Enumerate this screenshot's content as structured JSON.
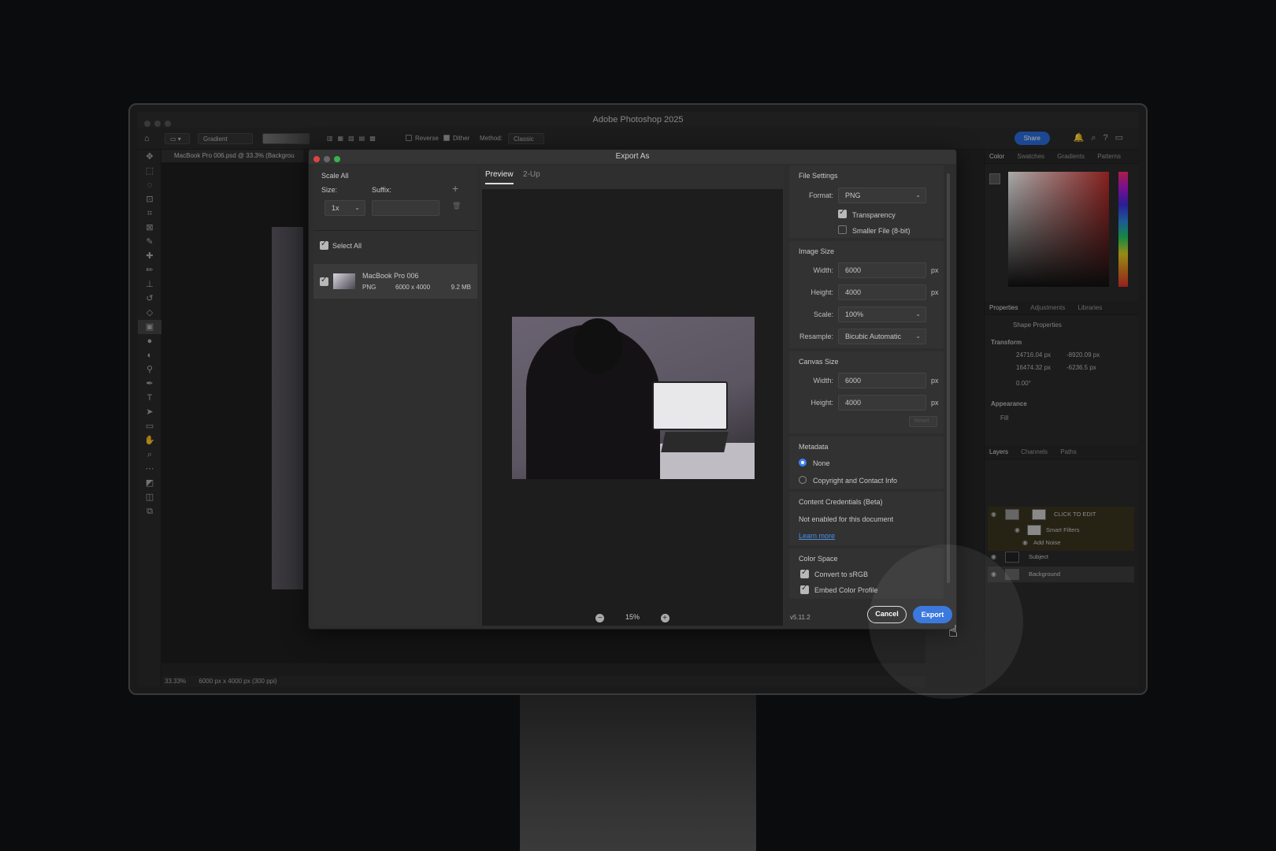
{
  "app": {
    "title": "Adobe Photoshop 2025",
    "options_bar": {
      "tool_preset": "Gradient",
      "reverse_label": "Reverse",
      "dither_label": "Dither",
      "method_label": "Method:",
      "method_value": "Classic",
      "share_label": "Share"
    },
    "document_tab": "MacBook Pro 006.psd @ 33.3% (Backgrou",
    "status": {
      "zoom": "33.33%",
      "info": "6000 px x 4000 px (300 ppi)"
    }
  },
  "panels": {
    "color_tabs": [
      "Color",
      "Swatches",
      "Gradients",
      "Patterns"
    ],
    "properties_tabs": [
      "Properties",
      "Adjustments",
      "Libraries"
    ],
    "shape_properties_label": "Shape Properties",
    "transform_label": "Transform",
    "w_value": "24716.04 px",
    "h_value": "16474.32 px",
    "x_value": "-8920.09 px",
    "y_value": "-6236.5 px",
    "angle_value": "0.00°",
    "appearance_label": "Appearance",
    "fill_label": "Fill",
    "layers_tabs": [
      "Layers",
      "Channels",
      "Paths"
    ],
    "layers": [
      {
        "name": "CLICK TO EDIT"
      },
      {
        "name": "Smart Filters"
      },
      {
        "name": "Add Noise"
      },
      {
        "name": "Subject"
      },
      {
        "name": "Background"
      }
    ]
  },
  "dialog": {
    "title": "Export As",
    "scale_all_label": "Scale All",
    "size_label": "Size:",
    "suffix_label": "Suffix:",
    "size_value": "1x",
    "select_all_label": "Select All",
    "asset": {
      "name": "MacBook Pro 006",
      "format": "PNG",
      "dimensions": "6000 x 4000",
      "file_size": "9.2 MB"
    },
    "tabs": [
      "Preview",
      "2-Up"
    ],
    "zoom_level": "15%",
    "file_settings": {
      "title": "File Settings",
      "format_label": "Format:",
      "format_value": "PNG",
      "transparency_label": "Transparency",
      "smaller_file_label": "Smaller File (8-bit)"
    },
    "image_size": {
      "title": "Image Size",
      "width_label": "Width:",
      "width_value": "6000",
      "height_label": "Height:",
      "height_value": "4000",
      "scale_label": "Scale:",
      "scale_value": "100%",
      "resample_label": "Resample:",
      "resample_value": "Bicubic Automatic",
      "unit": "px"
    },
    "canvas_size": {
      "title": "Canvas Size",
      "width_label": "Width:",
      "width_value": "6000",
      "height_label": "Height:",
      "height_value": "4000",
      "unit": "px",
      "reset_label": "Reset"
    },
    "metadata": {
      "title": "Metadata",
      "none_label": "None",
      "copyright_label": "Copyright and Contact Info"
    },
    "content_credentials": {
      "title": "Content Credentials (Beta)",
      "status": "Not enabled for this document",
      "learn_more": "Learn more"
    },
    "color_space": {
      "title": "Color Space",
      "convert_label": "Convert to sRGB",
      "embed_label": "Embed Color Profile"
    },
    "version": "v5.11.2",
    "cancel_label": "Cancel",
    "export_label": "Export"
  }
}
